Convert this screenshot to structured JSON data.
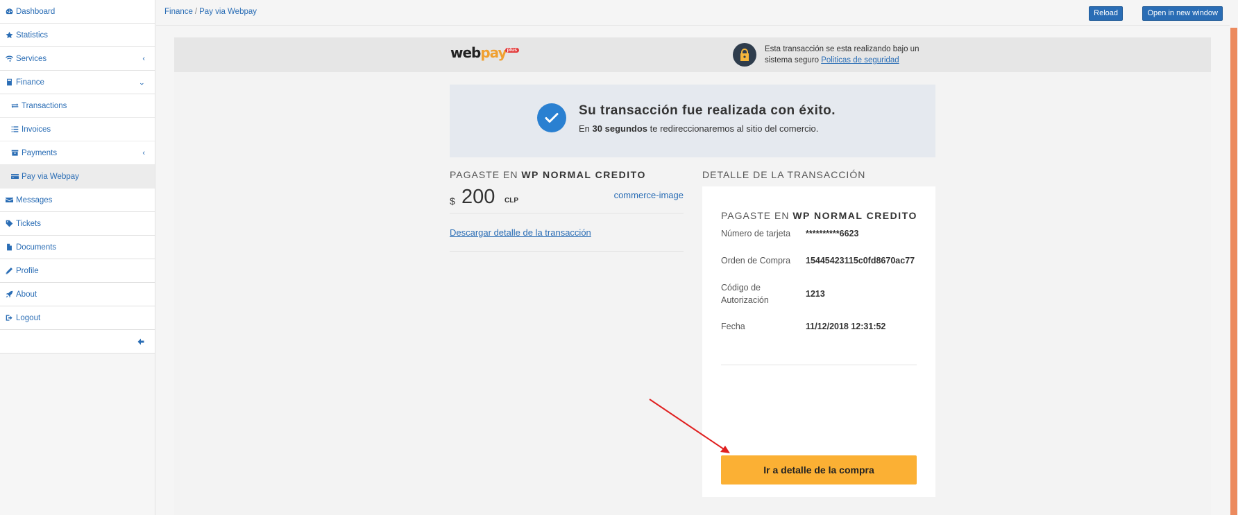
{
  "sidebar": {
    "items": [
      {
        "label": "Dashboard",
        "icon": "dashboard-icon"
      },
      {
        "label": "Statistics",
        "icon": "star-icon"
      },
      {
        "label": "Services",
        "icon": "wifi-icon",
        "chevron": "‹"
      },
      {
        "label": "Finance",
        "icon": "calculator-icon",
        "chevron": "⌄"
      },
      {
        "label": "Transactions",
        "icon": "exchange-icon"
      },
      {
        "label": "Invoices",
        "icon": "list-icon"
      },
      {
        "label": "Payments",
        "icon": "archive-icon",
        "chevron": "‹"
      },
      {
        "label": "Pay via Webpay",
        "icon": "credit-card-icon"
      },
      {
        "label": "Messages",
        "icon": "envelope-icon"
      },
      {
        "label": "Tickets",
        "icon": "tag-icon"
      },
      {
        "label": "Documents",
        "icon": "file-icon"
      },
      {
        "label": "Profile",
        "icon": "pencil-icon"
      },
      {
        "label": "About",
        "icon": "rocket-icon"
      },
      {
        "label": "Logout",
        "icon": "sign-out-icon"
      }
    ]
  },
  "topbar": {
    "breadcrumb": [
      "Finance",
      "Pay via Webpay"
    ],
    "reload_label": "Reload",
    "open_label": "Open in new window"
  },
  "webpay": {
    "logo_web": "web",
    "logo_pay": "pay",
    "logo_plus": "plus",
    "secure_text": "Esta transacción se esta realizando bajo un sistema seguro",
    "secure_link": "Politicas de seguridad",
    "success_title": "Su transacción fue realizada con éxito.",
    "success_sub_pre": "En",
    "success_sub_bold": "30 segundos",
    "success_sub_post": "te redireccionaremos al sitio del comercio.",
    "pagaste_pre": "PAGASTE EN",
    "merchant": "WP NORMAL CREDITO",
    "currency_symbol": "$",
    "amount": "200",
    "currency_code": "CLP",
    "commerce_image": "commerce-image",
    "download_link": "Descargar detalle de la transacción",
    "detail_title": "DETALLE DE LA TRANSACCIÓN",
    "card_label": "Número de tarjeta",
    "card_value": "**********6623",
    "order_label": "Orden de Compra",
    "order_value": "15445423115c0fd8670ac77",
    "auth_label": "Código de Autorización",
    "auth_value": "1213",
    "date_label": "Fecha",
    "date_value": "11/12/2018 12:31:52",
    "buy_button": "Ir a detalle de la compra"
  },
  "colors": {
    "link": "#2a6db5",
    "accent_button": "#fbb034",
    "check": "#2a80d1",
    "arrow": "#e02020"
  }
}
